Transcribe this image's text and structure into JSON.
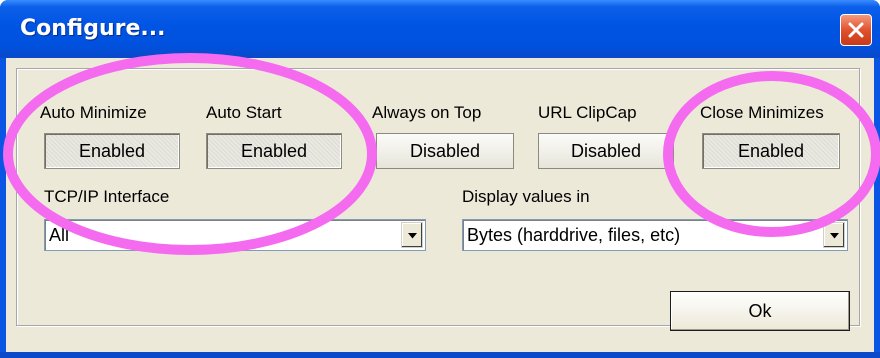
{
  "window": {
    "title": "Configure..."
  },
  "toggles": [
    {
      "label": "Auto Minimize",
      "state": "Enabled"
    },
    {
      "label": "Auto Start",
      "state": "Enabled"
    },
    {
      "label": "Always on Top",
      "state": "Disabled"
    },
    {
      "label": "URL ClipCap",
      "state": "Disabled"
    },
    {
      "label": "Close Minimizes",
      "state": "Enabled"
    }
  ],
  "tcpip": {
    "label": "TCP/IP Interface",
    "value": "All"
  },
  "display": {
    "label": "Display values in",
    "value": "Bytes (harddrive, files, etc)"
  },
  "ok_label": "Ok",
  "annotation_color": "#f46bf0",
  "icons": {
    "close": "close-icon",
    "dropdown": "chevron-down-icon"
  }
}
